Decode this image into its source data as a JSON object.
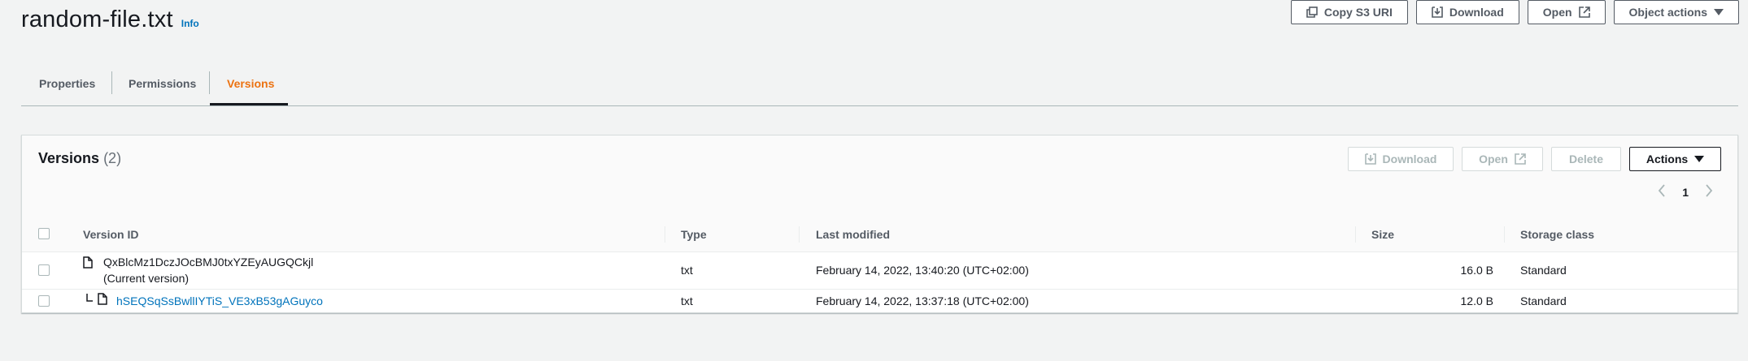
{
  "header": {
    "title": "random-file.txt",
    "info_label": "Info"
  },
  "top_actions": {
    "copy_s3_uri": "Copy S3 URI",
    "download": "Download",
    "open": "Open",
    "object_actions": "Object actions"
  },
  "tabs": [
    {
      "label": "Properties"
    },
    {
      "label": "Permissions"
    },
    {
      "label": "Versions"
    }
  ],
  "active_tab": "Versions",
  "versions_panel": {
    "title": "Versions",
    "count": "(2)",
    "actions": {
      "download": "Download",
      "open": "Open",
      "delete": "Delete",
      "actions": "Actions"
    },
    "pagination": {
      "current_page": "1"
    },
    "columns": [
      "Version ID",
      "Type",
      "Last modified",
      "Size",
      "Storage class"
    ],
    "rows": [
      {
        "version_id": "QxBlcMz1DczJOcBMJ0txYZEyAUGQCkjl",
        "note": "(Current version)",
        "type": "txt",
        "last_modified": "February 14, 2022, 13:40:20 (UTC+02:00)",
        "size": "16.0 B",
        "storage_class": "Standard"
      },
      {
        "version_id": "hSEQSqSsBwllIYTiS_VE3xB53gAGuyco",
        "type": "txt",
        "last_modified": "February 14, 2022, 13:37:18 (UTC+02:00)",
        "size": "12.0 B",
        "storage_class": "Standard"
      }
    ]
  },
  "colors": {
    "accent": "#ec7211",
    "link": "#0073bb",
    "text": "#16191f",
    "background": "#f2f3f3"
  },
  "icons": [
    "copy-icon",
    "download-icon",
    "external-link-icon",
    "caret-down-icon",
    "file-icon",
    "chevron-left-icon",
    "chevron-right-icon",
    "tree-connector-icon"
  ]
}
